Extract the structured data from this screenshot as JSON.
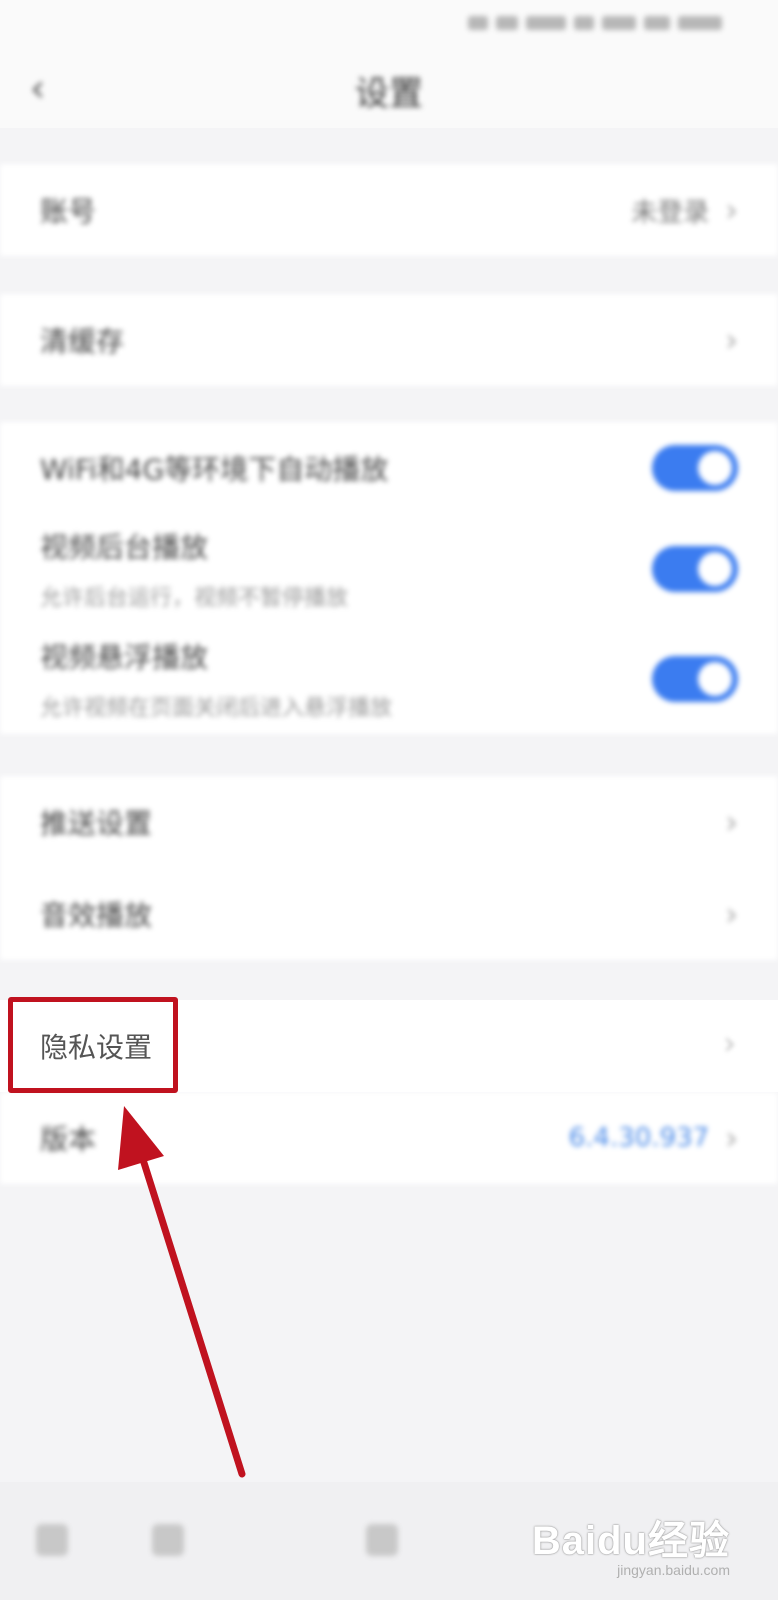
{
  "status_bar": {
    "time": ""
  },
  "header": {
    "title": "设置"
  },
  "sections": {
    "account": {
      "label": "账号",
      "value": "未登录"
    },
    "cache": {
      "label": "清缓存"
    },
    "toggles": [
      {
        "label": "WiFi和4G等环境下自动播放",
        "sub": "",
        "state": "on"
      },
      {
        "label": "视频后台播放",
        "sub": "允许后台运行，视频不暂停播放",
        "state": "on"
      },
      {
        "label": "视频悬浮播放",
        "sub": "允许视频在页面关闭后进入悬浮播放",
        "state": "on"
      }
    ],
    "misc": [
      {
        "label": "推送设置"
      },
      {
        "label": "音效播放"
      }
    ],
    "privacy": {
      "label": "隐私设置"
    },
    "version": {
      "label": "版本",
      "value": "6.4.30.937"
    }
  },
  "watermark": {
    "brand": "Baidu经验",
    "url": "jingyan.baidu.com"
  },
  "colors": {
    "toggle_on": "#3b7cf0",
    "highlight": "#c0121f",
    "version_value": "#4a8ae8"
  }
}
